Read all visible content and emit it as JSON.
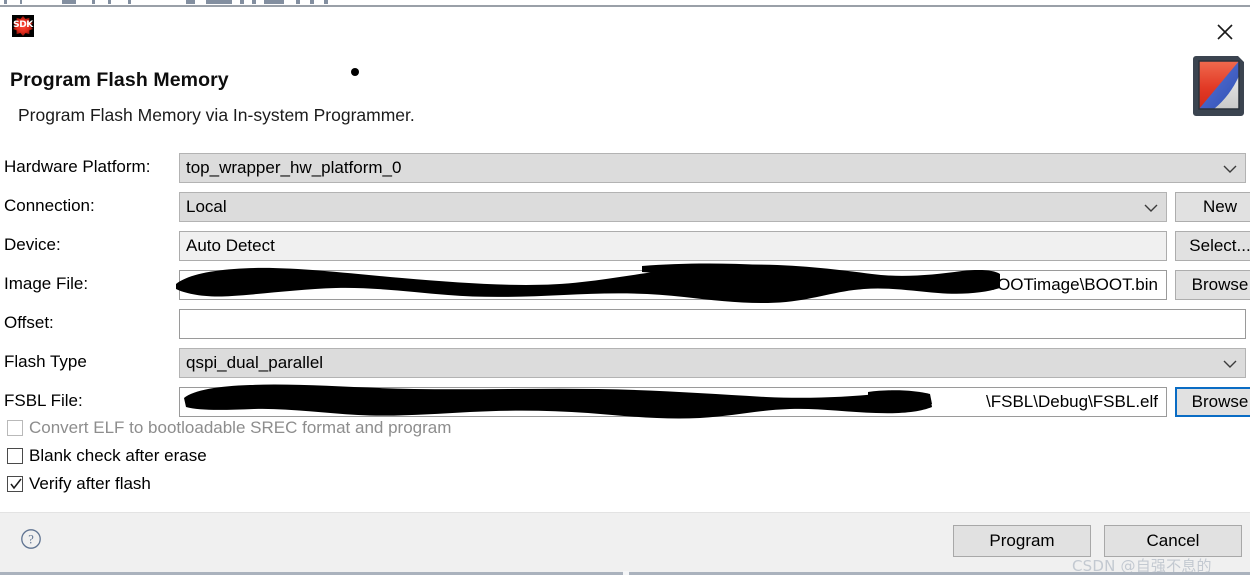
{
  "window": {
    "title": "Program Flash Memory",
    "description": "Program Flash Memory via In-system Programmer.",
    "close_icon": "close-icon",
    "app_icon_label": "SDK",
    "banner_icon": "xilinx-sdk-banner-image"
  },
  "form": {
    "rows": [
      {
        "label": "Hardware Platform:",
        "value": "top_wrapper_hw_platform_0",
        "kind": "combo",
        "redacted": false,
        "button": null
      },
      {
        "label": "Connection:",
        "value": "Local",
        "kind": "combo",
        "redacted": false,
        "button": "New"
      },
      {
        "label": "Device:",
        "value": "Auto Detect",
        "kind": "readonly",
        "redacted": false,
        "button": "Select..."
      },
      {
        "label": "Image File:",
        "value": "k\\BOOTimage\\BOOT.bin",
        "kind": "text",
        "redacted": true,
        "button": "Browse"
      },
      {
        "label": "Offset:",
        "value": "",
        "kind": "text",
        "redacted": false,
        "button": null
      },
      {
        "label": "Flash Type",
        "value": "qspi_dual_parallel",
        "kind": "combo",
        "redacted": false,
        "button": null
      },
      {
        "label": "FSBL File:",
        "value": "\\FSBL\\Debug\\FSBL.elf",
        "kind": "text",
        "redacted": true,
        "button": "Browse"
      }
    ]
  },
  "checkboxes": [
    {
      "label": "Convert ELF to bootloadable SREC format and program",
      "checked": false,
      "disabled": true
    },
    {
      "label": "Blank check after erase",
      "checked": false,
      "disabled": false
    },
    {
      "label": "Verify after flash",
      "checked": true,
      "disabled": false
    }
  ],
  "footer": {
    "help_icon": "help-icon",
    "program_label": "Program",
    "cancel_label": "Cancel",
    "watermark": "CSDN @自强不息的"
  },
  "colors": {
    "focus_blue": "#0a6cc4",
    "combo_background": "#dcdcdc",
    "readonly_background": "#f0f0f0",
    "footer_background": "#f0f0f0",
    "redaction": "#000000"
  }
}
